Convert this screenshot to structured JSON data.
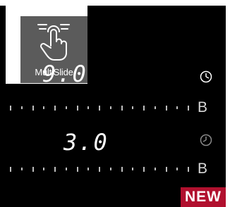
{
  "multislide": {
    "label": "MultiSlide",
    "icon": "hand-swipe-icon"
  },
  "zones": [
    {
      "display": "9.0",
      "slider_label": "B",
      "timer_icon": "timer-icon"
    },
    {
      "display": "3.0",
      "slider_label": "B",
      "timer_icon": "timer-icon"
    }
  ],
  "badge": {
    "label": "NEW",
    "color": "#b1102e"
  },
  "colors": {
    "panel": "#000000",
    "badge_bg": "#5b5b5b"
  }
}
